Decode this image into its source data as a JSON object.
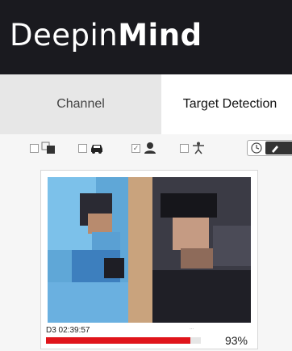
{
  "app": {
    "logo_light": "Deepin",
    "logo_bold": "Mind"
  },
  "tabs": [
    {
      "label": "Channel",
      "active": false
    },
    {
      "label": "Target Detection",
      "active": true
    }
  ],
  "filters": [
    {
      "name": "face-region",
      "icon": "face-region-icon",
      "checked": false
    },
    {
      "name": "vehicle",
      "icon": "car-icon",
      "checked": false
    },
    {
      "name": "human",
      "icon": "person-icon",
      "checked": true
    },
    {
      "name": "body",
      "icon": "body-icon",
      "checked": false
    }
  ],
  "result": {
    "timestamp": "D3 02:39:57",
    "small_text": "...",
    "similarity_percent": 93,
    "similarity_label": "93%"
  },
  "colors": {
    "header_bg": "#1a1a1f",
    "accent_red": "#e0151b"
  }
}
